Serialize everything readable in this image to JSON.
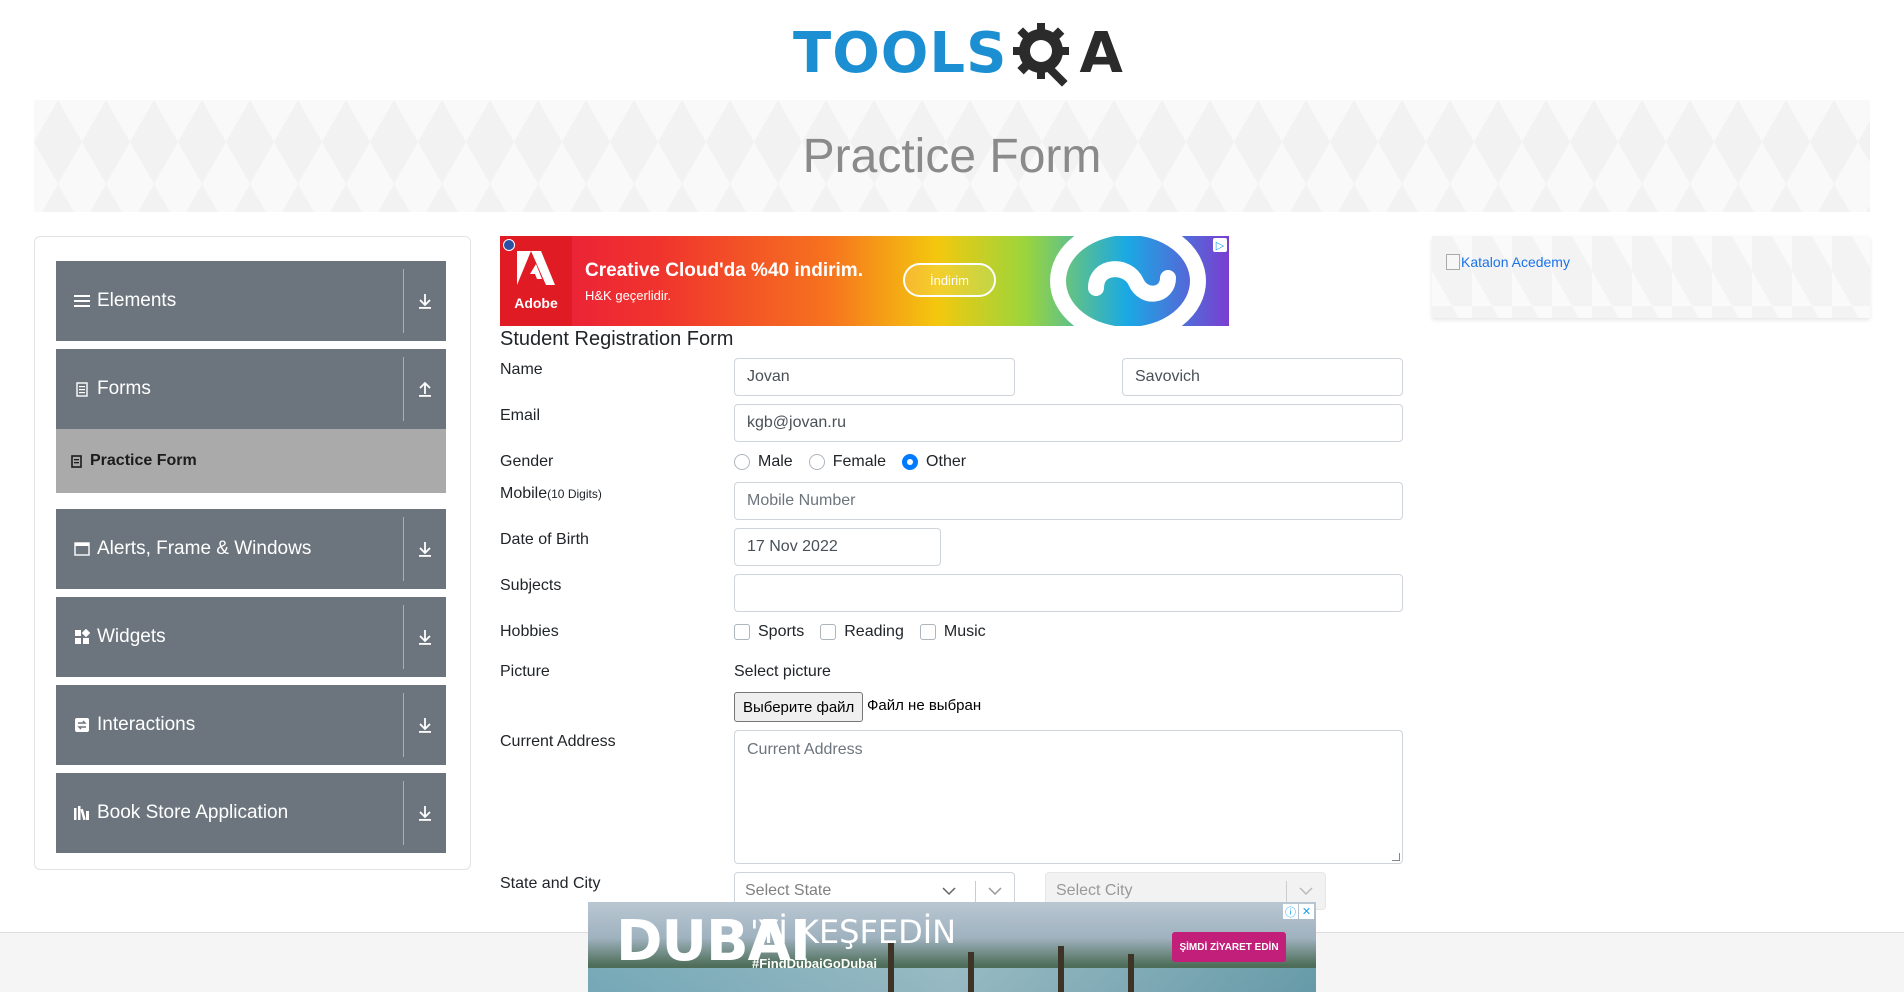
{
  "logo": {
    "text_part": "TOOLS",
    "qa_part": "A"
  },
  "page_title": "Practice Form",
  "sidebar": {
    "groups": [
      {
        "label": "Elements",
        "icon": "hamburger-icon",
        "arrow": "download-arrow-icon"
      },
      {
        "label": "Forms",
        "icon": "document-icon",
        "arrow": "upload-arrow-icon"
      },
      {
        "label": "Alerts, Frame & Windows",
        "icon": "window-icon",
        "arrow": "download-arrow-icon"
      },
      {
        "label": "Widgets",
        "icon": "widgets-icon",
        "arrow": "download-arrow-icon"
      },
      {
        "label": "Interactions",
        "icon": "interactions-icon",
        "arrow": "download-arrow-icon"
      },
      {
        "label": "Book Store Application",
        "icon": "books-icon",
        "arrow": "download-arrow-icon"
      }
    ],
    "active_item": "Practice Form"
  },
  "ad_top": {
    "brand": "Adobe",
    "headline": "Creative Cloud'da %40 indirim.",
    "sub": "H&K geçerlidir.",
    "button": "İndirim"
  },
  "ad_right": {
    "alt": "Katalon Acedemy"
  },
  "form": {
    "title": "Student Registration Form",
    "name_label": "Name",
    "first_name": "Jovan",
    "last_name": "Savovich",
    "email_label": "Email",
    "email": "kgb@jovan.ru",
    "gender_label": "Gender",
    "genders": [
      "Male",
      "Female",
      "Other"
    ],
    "gender_selected": "Other",
    "mobile_label": "Mobile",
    "mobile_hint": "(10 Digits)",
    "mobile_placeholder": "Mobile Number",
    "dob_label": "Date of Birth",
    "dob": "17 Nov 2022",
    "subjects_label": "Subjects",
    "hobbies_label": "Hobbies",
    "hobbies": [
      "Sports",
      "Reading",
      "Music"
    ],
    "picture_label": "Picture",
    "picture_prompt": "Select picture",
    "file_button": "Выберите файл",
    "file_status": "Файл не выбран",
    "address_label": "Current Address",
    "address_placeholder": "Current Address",
    "state_city_label": "State and City",
    "state_placeholder": "Select State",
    "city_placeholder": "Select City"
  },
  "ad_bottom": {
    "title": "DUBAI",
    "subtitle": "'Yİ KEŞFEDİN",
    "hashtag": "#FindDubaiGoDubai",
    "button": "ŞİMDİ ZİYARET EDİN"
  },
  "colors": {
    "accent": "#1b8fd1",
    "sidebar_bg": "#6c757d",
    "active_item_bg": "#aaaaaa",
    "radio_checked": "#007bff"
  }
}
